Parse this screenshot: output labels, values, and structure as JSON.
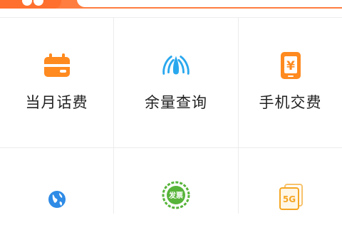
{
  "header": {
    "brand_color": "#ff7d3f",
    "search_placeholder": ""
  },
  "services": [
    {
      "label": "当月话费",
      "icon": "wallet-card-icon",
      "color": "#ff8a1f"
    },
    {
      "label": "余量查询",
      "icon": "signal-gauge-icon",
      "color": "#2aa8ee"
    },
    {
      "label": "手机交费",
      "icon": "phone-yen-icon",
      "color": "#ff8a1f"
    },
    {
      "label": "",
      "icon": "globe-icon",
      "color": "#2f8be6"
    },
    {
      "label": "",
      "icon": "invoice-badge-icon",
      "color": "#57b43a",
      "icon_text": "发票"
    },
    {
      "label": "",
      "icon": "5g-card-icon",
      "color": "#f5a623",
      "icon_text": "5G"
    }
  ]
}
